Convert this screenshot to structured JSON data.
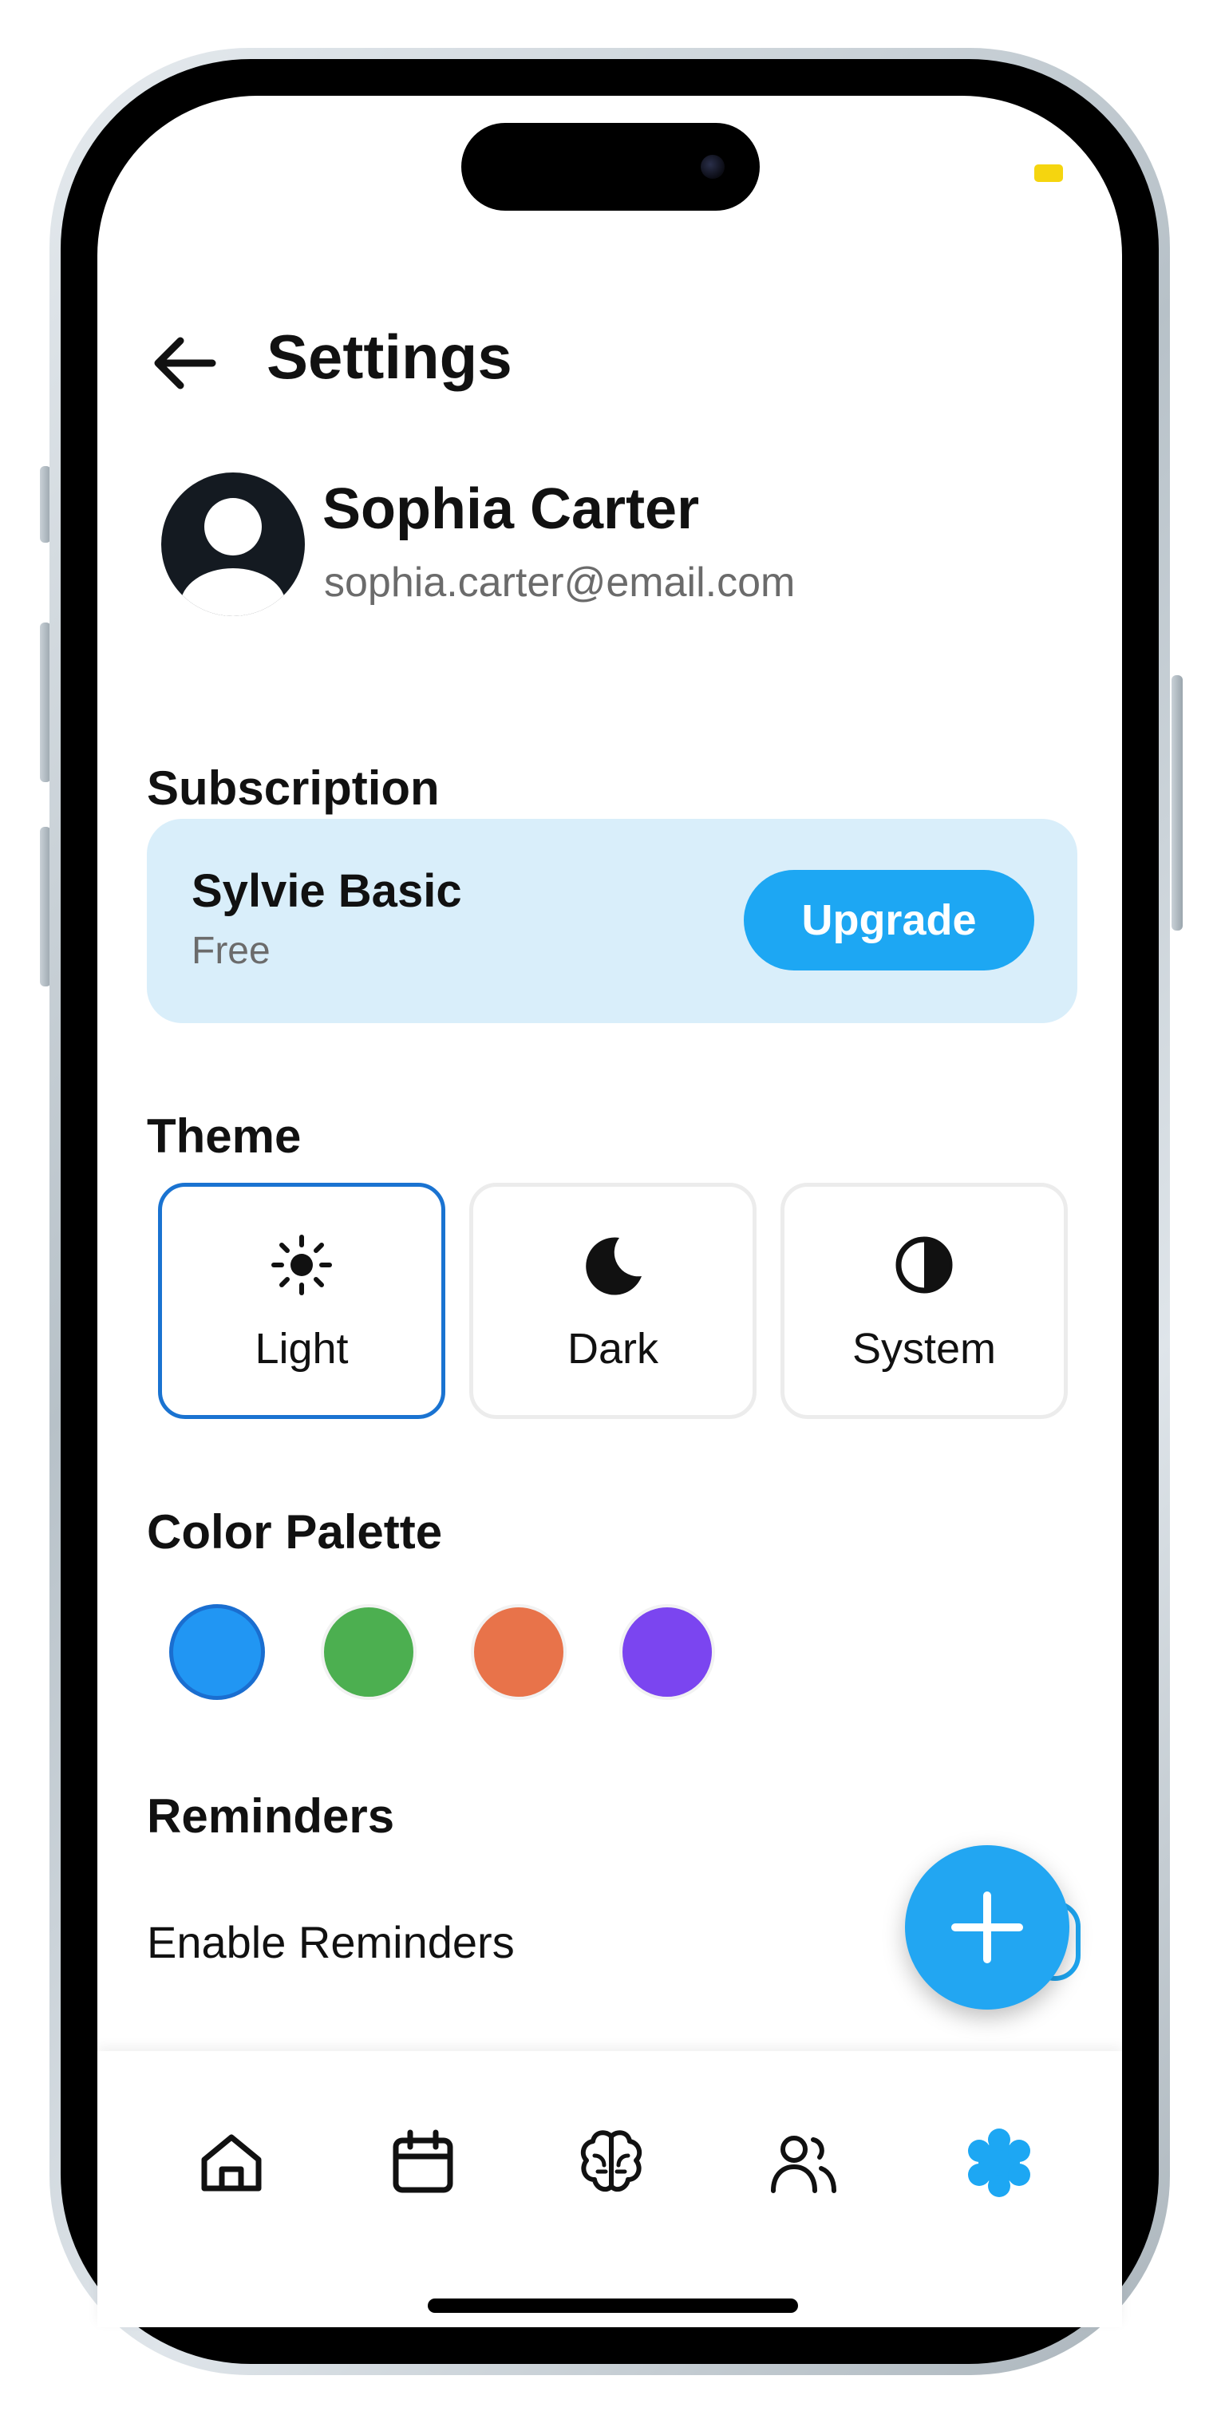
{
  "header": {
    "title": "Settings",
    "back_icon": "arrow-left-icon"
  },
  "profile": {
    "name": "Sophia Carter",
    "email": "sophia.carter@email.com",
    "avatar_icon": "user-avatar-icon"
  },
  "subscription": {
    "section_title": "Subscription",
    "plan_name": "Sylvie Basic",
    "plan_tier": "Free",
    "upgrade_label": "Upgrade",
    "card_color": "#d9eefa",
    "button_color": "#1da7f3"
  },
  "theme": {
    "section_title": "Theme",
    "selected": "Light",
    "options": [
      {
        "label": "Light",
        "icon": "sun-icon"
      },
      {
        "label": "Dark",
        "icon": "moon-icon"
      },
      {
        "label": "System",
        "icon": "contrast-icon"
      }
    ],
    "selected_border_color": "#1a73d1"
  },
  "palette": {
    "section_title": "Color Palette",
    "selected": "#2196f3",
    "colors": [
      "#2196f3",
      "#4caf50",
      "#e8734a",
      "#7b45f0"
    ]
  },
  "reminders": {
    "section_title": "Reminders",
    "enable_label": "Enable Reminders",
    "fab_icon": "plus-icon"
  },
  "nav": {
    "items": [
      {
        "icon": "home-icon",
        "active": false
      },
      {
        "icon": "calendar-icon",
        "active": false
      },
      {
        "icon": "brain-icon",
        "active": false
      },
      {
        "icon": "users-icon",
        "active": false
      },
      {
        "icon": "gear-icon",
        "active": true
      }
    ],
    "active_color": "#1da7f3"
  }
}
